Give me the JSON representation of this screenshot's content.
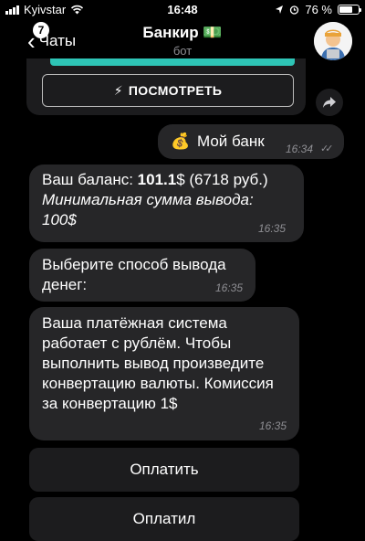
{
  "status_bar": {
    "carrier": "Kyivstar",
    "time": "16:48",
    "battery": "76 %",
    "battery_level": 0.76
  },
  "header": {
    "back_label": "Чаты",
    "unread_count": "7",
    "title": "Банкир 💵",
    "subtitle": "бот"
  },
  "inline_button": {
    "icon": "⚡",
    "label": "ПОСМОТРЕТЬ"
  },
  "messages": {
    "outgoing": {
      "emoji": "💰",
      "text": "Мой банк",
      "time": "16:34"
    },
    "balance": {
      "prefix": "Ваш баланс: ",
      "amount": "101.1",
      "suffix": "$ (6718 руб.)",
      "min_label": "Минимальная сумма вывода:",
      "min_value": "100$",
      "time": "16:35"
    },
    "choose_method": {
      "text": "Выберите способ вывода денег:",
      "time": "16:35"
    },
    "payment_system": {
      "text": "Ваша платёжная система работает с рублём. Чтобы выполнить вывод произведите конвертацию валюты. Комиссия за конвертацию 1$",
      "time": "16:35"
    }
  },
  "keyboard": {
    "pay": "Оплатить",
    "paid": "Оплатил"
  },
  "colors": {
    "background": "#000000",
    "bubble": "#262628",
    "accent_strip": "#2ec4b6"
  }
}
